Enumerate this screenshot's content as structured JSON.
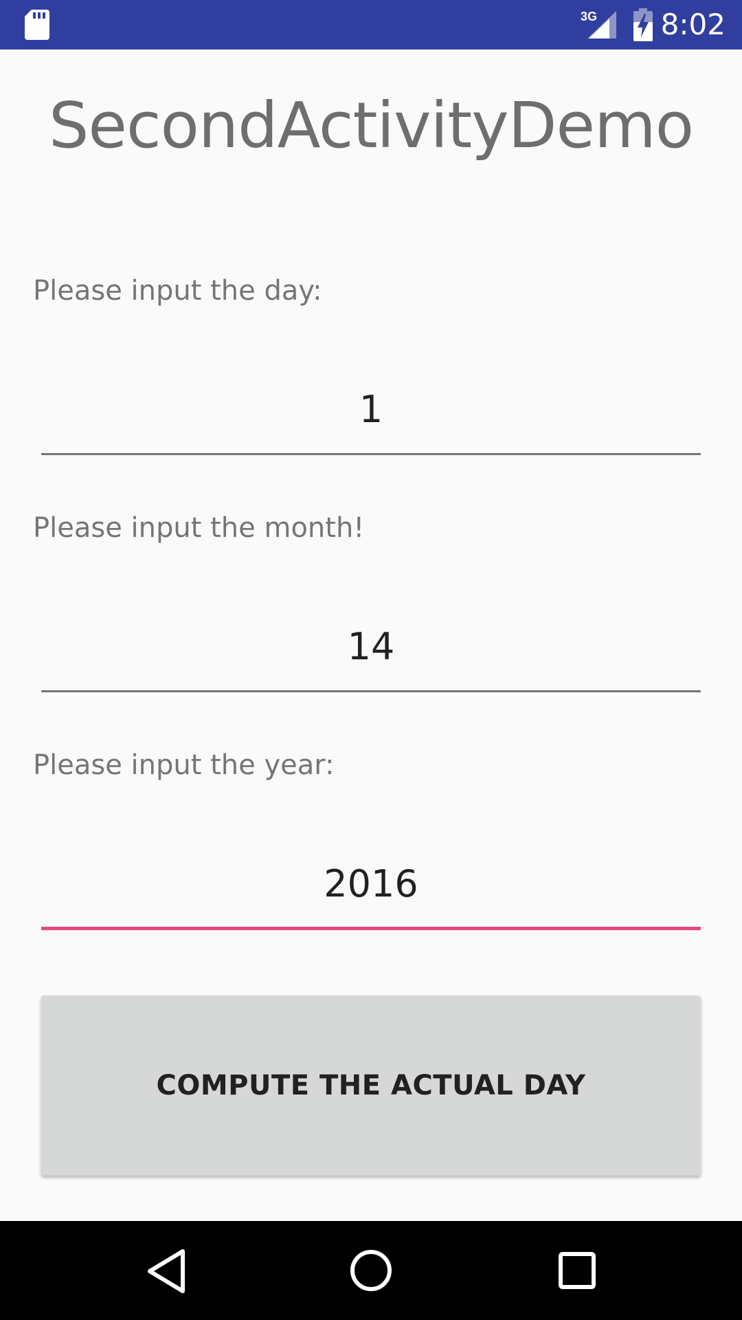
{
  "status_bar": {
    "time": "8:02",
    "network_type": "3G",
    "icons": [
      "sd-card-icon",
      "signal-3g-icon",
      "battery-charging-icon"
    ],
    "background": "#303f9f"
  },
  "app": {
    "title": "SecondActivityDemo"
  },
  "form": {
    "day": {
      "label": "Please input the day:",
      "value": "1"
    },
    "month": {
      "label": "Please input the month!",
      "value": "14"
    },
    "year": {
      "label": "Please input the year:",
      "value": "2016",
      "focused": true
    }
  },
  "actions": {
    "compute_label": "COMPUTE THE ACTUAL DAY"
  },
  "colors": {
    "accent": "#e84879",
    "primary_dark": "#303f9f",
    "button_bg": "#d6d7d7"
  },
  "nav_bar": {
    "icons": [
      "back-icon",
      "home-icon",
      "recents-icon"
    ]
  }
}
